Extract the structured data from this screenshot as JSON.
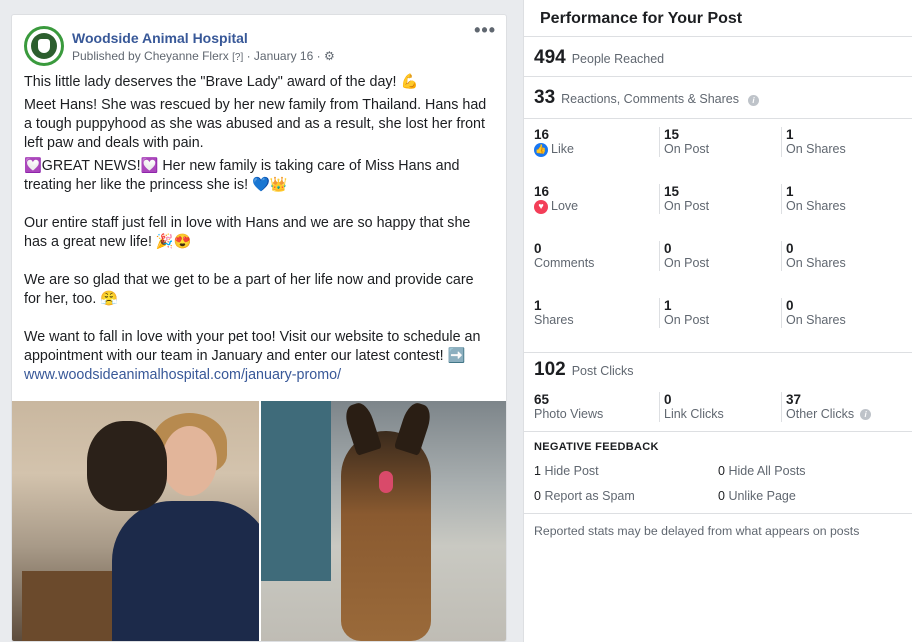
{
  "post": {
    "page_name": "Woodside Animal Hospital",
    "published_prefix": "Published by Cheyanne Flerx",
    "published_q": "[?]",
    "date": "· January 16 ·",
    "more": "•••",
    "paragraphs": [
      "This little lady deserves the \"Brave Lady\" award of the day! 💪",
      "Meet Hans! She was rescued by her new family from Thailand. Hans had a tough puppyhood as she was abused and as a result, she lost her front left paw and deals with pain.",
      "💟GREAT NEWS!💟 Her new family is taking care of Miss Hans and treating her like the princess she is! 💙👑",
      "Our entire staff just fell in love with Hans and we are so happy that she has a great new life! 🎉😍",
      "We are so glad that we get to be a part of her life now and provide care for her, too. 😤",
      "We want to fall in love with your pet too! Visit our website to schedule an appointment with our team in January and enter our latest contest! ➡️"
    ],
    "link": "www.woodsideanimalhospital.com/january-promo/"
  },
  "panel": {
    "title": "Performance for Your Post",
    "reached_num": "494",
    "reached_label": "People Reached",
    "engage_num": "33",
    "engage_label": "Reactions, Comments & Shares",
    "rows": [
      {
        "a_num": "16",
        "a_label": "Like",
        "b_num": "15",
        "b_label": "On Post",
        "c_num": "1",
        "c_label": "On Shares"
      },
      {
        "a_num": "16",
        "a_label": "Love",
        "b_num": "15",
        "b_label": "On Post",
        "c_num": "1",
        "c_label": "On Shares"
      },
      {
        "a_num": "0",
        "a_label": "Comments",
        "b_num": "0",
        "b_label": "On Post",
        "c_num": "0",
        "c_label": "On Shares"
      },
      {
        "a_num": "1",
        "a_label": "Shares",
        "b_num": "1",
        "b_label": "On Post",
        "c_num": "0",
        "c_label": "On Shares"
      }
    ],
    "clicks_num": "102",
    "clicks_label": "Post Clicks",
    "clicks": {
      "a_num": "65",
      "a_label": "Photo Views",
      "b_num": "0",
      "b_label": "Link Clicks",
      "c_num": "37",
      "c_label": "Other Clicks"
    },
    "negative_title": "NEGATIVE FEEDBACK",
    "negative": {
      "hide_post_num": "1",
      "hide_post_label": "Hide Post",
      "hide_all_num": "0",
      "hide_all_label": "Hide All Posts",
      "spam_num": "0",
      "spam_label": "Report as Spam",
      "unlike_num": "0",
      "unlike_label": "Unlike Page"
    },
    "footer": "Reported stats may be delayed from what appears on posts"
  }
}
